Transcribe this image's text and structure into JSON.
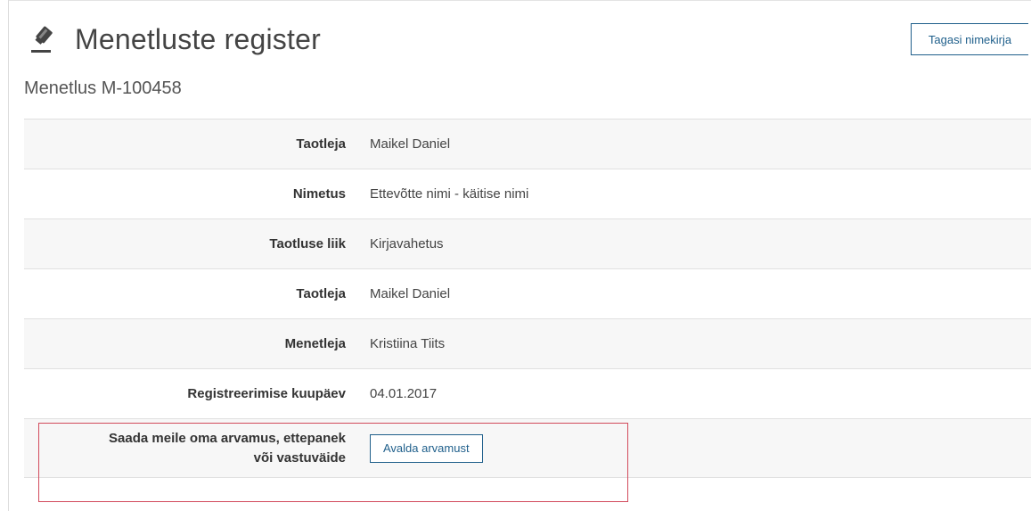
{
  "header": {
    "title": "Menetluste register",
    "icon": "gavel-icon",
    "back_button": "Tagasi nimekirja"
  },
  "subtitle": "Menetlus M-100458",
  "details": {
    "rows": [
      {
        "label": "Taotleja",
        "value": "Maikel Daniel"
      },
      {
        "label": "Nimetus",
        "value": "Ettevõtte nimi - käitise nimi"
      },
      {
        "label": "Taotluse liik",
        "value": "Kirjavahetus"
      },
      {
        "label": "Taotleja",
        "value": "Maikel Daniel"
      },
      {
        "label": "Menetleja",
        "value": "Kristiina Tiits"
      },
      {
        "label": "Registreerimise kuupäev",
        "value": "04.01.2017"
      }
    ],
    "opinion_label_line1": "Saada meile oma arvamus, ettepanek",
    "opinion_label_line2": "või vastuväide",
    "opinion_button": "Avalda arvamust"
  },
  "colors": {
    "accent": "#1f5f8b",
    "highlight": "#d24b5c",
    "row_shade": "#f7f7f7"
  }
}
